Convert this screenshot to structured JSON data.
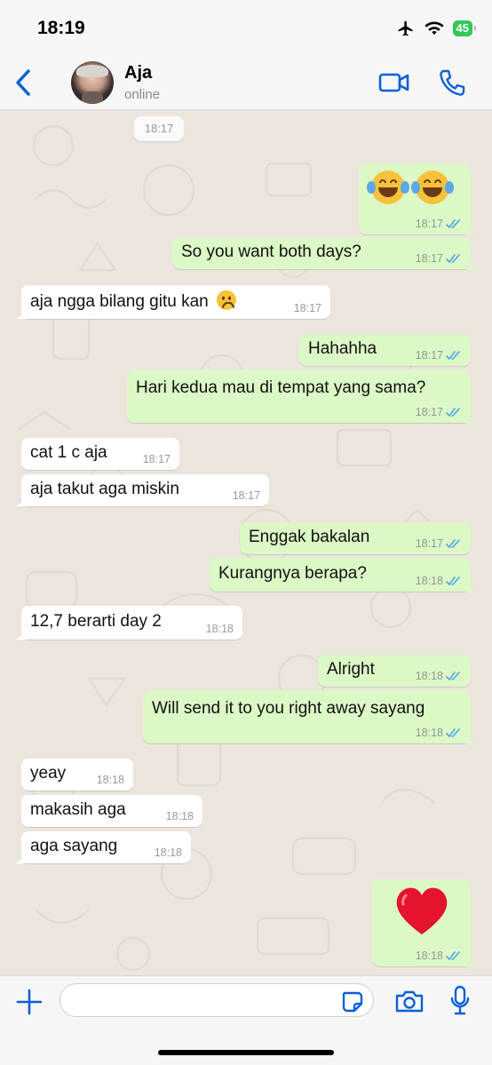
{
  "status_bar": {
    "time": "18:19",
    "battery": "45"
  },
  "header": {
    "contact_name": "Aja",
    "contact_status": "online"
  },
  "chat": {
    "top_time": "18:17",
    "messages": [
      {
        "id": "m1",
        "dir": "out",
        "kind": "emoji",
        "text": "😂😂",
        "time": "18:17"
      },
      {
        "id": "m2",
        "dir": "out",
        "text": "So you want both days?",
        "time": "18:17"
      },
      {
        "id": "m3",
        "dir": "in",
        "text": "aja ngga bilang gitu kan",
        "emoji": "🙁",
        "time": "18:17"
      },
      {
        "id": "m4",
        "dir": "out",
        "text": "Hahahha",
        "time": "18:17"
      },
      {
        "id": "m5",
        "dir": "out",
        "text": "Hari kedua mau di tempat yang sama?",
        "time": "18:17"
      },
      {
        "id": "m6",
        "dir": "in",
        "text": "cat 1 c aja",
        "time": "18:17"
      },
      {
        "id": "m7",
        "dir": "in",
        "text": "aja takut aga miskin",
        "time": "18:17"
      },
      {
        "id": "m8",
        "dir": "out",
        "text": "Enggak bakalan",
        "time": "18:17"
      },
      {
        "id": "m9",
        "dir": "out",
        "text": "Kurangnya berapa?",
        "time": "18:18"
      },
      {
        "id": "m10",
        "dir": "in",
        "text": "12,7 berarti day 2",
        "time": "18:18"
      },
      {
        "id": "m11",
        "dir": "out",
        "text": "Alright",
        "time": "18:18"
      },
      {
        "id": "m12",
        "dir": "out",
        "text": "Will send it to you right away sayang",
        "time": "18:18"
      },
      {
        "id": "m13",
        "dir": "in",
        "text": "yeay",
        "time": "18:18"
      },
      {
        "id": "m14",
        "dir": "in",
        "text": "makasih aga",
        "time": "18:18"
      },
      {
        "id": "m15",
        "dir": "in",
        "text": "aga sayang",
        "time": "18:18"
      },
      {
        "id": "m16",
        "dir": "out",
        "kind": "emoji",
        "text": "❤️",
        "time": "18:18"
      }
    ]
  },
  "composer": {
    "placeholder": ""
  },
  "colors": {
    "accent": "#0a60d6",
    "outgoing_bubble": "#dcf8c6",
    "incoming_bubble": "#ffffff",
    "chat_background": "#ebe5de",
    "read_ticks": "#4fa6e6"
  },
  "icons": {
    "status": [
      "airplane-icon",
      "wifi-icon",
      "battery-icon"
    ],
    "header": [
      "back-chevron-icon",
      "video-camera-icon",
      "phone-icon"
    ],
    "composer": [
      "plus-icon",
      "sticker-icon",
      "camera-icon",
      "microphone-icon"
    ]
  }
}
